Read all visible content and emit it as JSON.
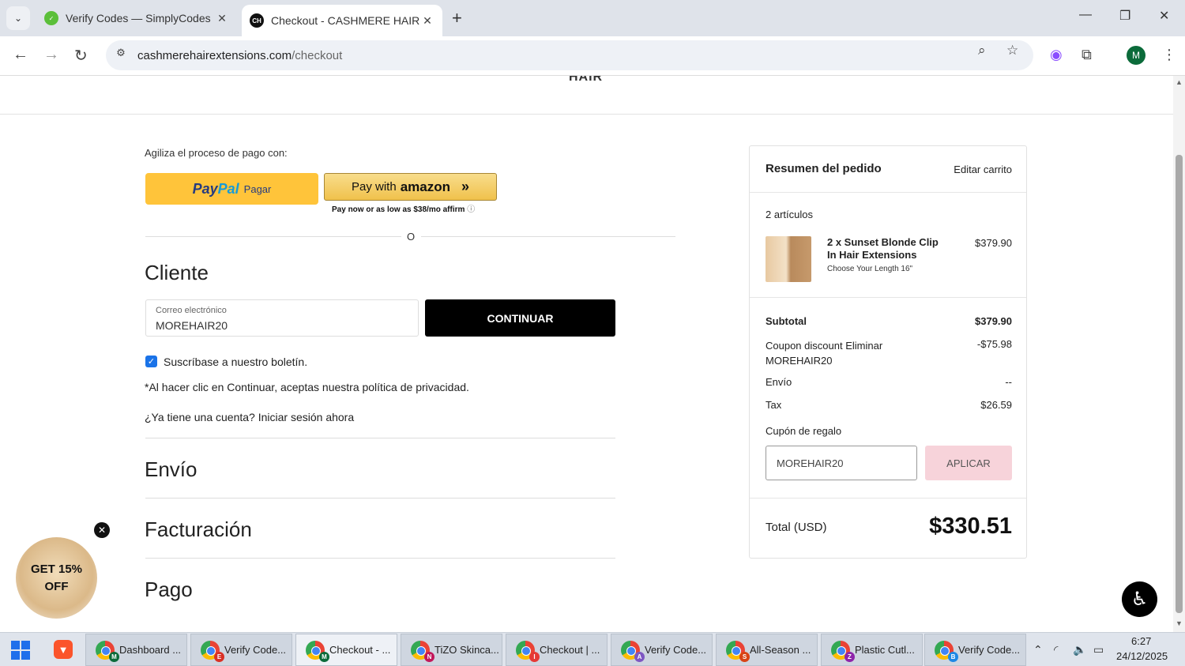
{
  "browser": {
    "tabs": [
      {
        "title": "Verify Codes — SimplyCodes",
        "favicon_color": "#5bbf3a",
        "active": false
      },
      {
        "title": "Checkout - CASHMERE HAIR",
        "favicon_text": "CH",
        "favicon_color": "#111111",
        "active": true
      }
    ],
    "url_domain": "cashmerehairextensions.com",
    "url_path": "/checkout",
    "profile_initial": "M"
  },
  "page": {
    "logo_partial": "HAIR",
    "quick_checkout_label": "Agiliza el proceso de pago con:",
    "paypal": {
      "brand_a": "Pay",
      "brand_b": "Pal",
      "label": "Pagar"
    },
    "amazon": {
      "prefix": "Pay with",
      "brand": "amazon",
      "chevron": "»"
    },
    "affirm_text": "Pay now or as low as $38/mo",
    "affirm_brand": "affirm",
    "or_text": "O",
    "customer": {
      "title": "Cliente",
      "email_label": "Correo electrónico",
      "email_value": "MOREHAIR20",
      "continue_label": "CONTINUAR",
      "newsletter_label": "Suscríbase a nuestro boletín.",
      "privacy_text": "*Al hacer clic en Continuar, aceptas nuestra política de privacidad.",
      "login_prompt": "¿Ya tiene una cuenta?",
      "login_link": "Iniciar sesión ahora"
    },
    "sections": [
      "Envío",
      "Facturación",
      "Pago"
    ]
  },
  "summary": {
    "title": "Resumen del pedido",
    "edit_cart": "Editar carrito",
    "items_count": "2 artículos",
    "product": {
      "name": "2 x Sunset Blonde Clip In Hair Extensions",
      "option": "Choose Your Length 16\"",
      "price": "$379.90"
    },
    "subtotal_label": "Subtotal",
    "subtotal_value": "$379.90",
    "coupon_label": "Coupon discount",
    "coupon_remove": "Eliminar",
    "coupon_code": "MOREHAIR20",
    "coupon_value": "-$75.98",
    "shipping_label": "Envío",
    "shipping_value": "--",
    "tax_label": "Tax",
    "tax_value": "$26.59",
    "gift_label": "Cupón de regalo",
    "gift_input_value": "MOREHAIR20",
    "apply_label": "APLICAR",
    "total_label": "Total (USD)",
    "total_value": "$330.51"
  },
  "promo": {
    "line1": "GET 15%",
    "line2": "OFF"
  },
  "taskbar": {
    "items": [
      {
        "label": "Dashboard ...",
        "badge": "M",
        "badge_color": "#0b6b3a"
      },
      {
        "label": "Verify Code...",
        "badge": "E",
        "badge_color": "#d93025"
      },
      {
        "label": "Checkout - ...",
        "badge": "M",
        "badge_color": "#0b6b3a",
        "active": true
      },
      {
        "label": "TiZO Skinca...",
        "badge": "N",
        "badge_color": "#c2185b"
      },
      {
        "label": "Checkout | ...",
        "badge": "I",
        "badge_color": "#e53935"
      },
      {
        "label": "Verify Code...",
        "badge": "A",
        "badge_color": "#7e57c2"
      },
      {
        "label": "All-Season ...",
        "badge": "S",
        "badge_color": "#d84315"
      },
      {
        "label": "Plastic Cutl...",
        "badge": "Z",
        "badge_color": "#8e24aa"
      },
      {
        "label": "Verify Code...",
        "badge": "B",
        "badge_color": "#1e88e5"
      }
    ],
    "time": "6:27",
    "date": "24/12/2025"
  }
}
